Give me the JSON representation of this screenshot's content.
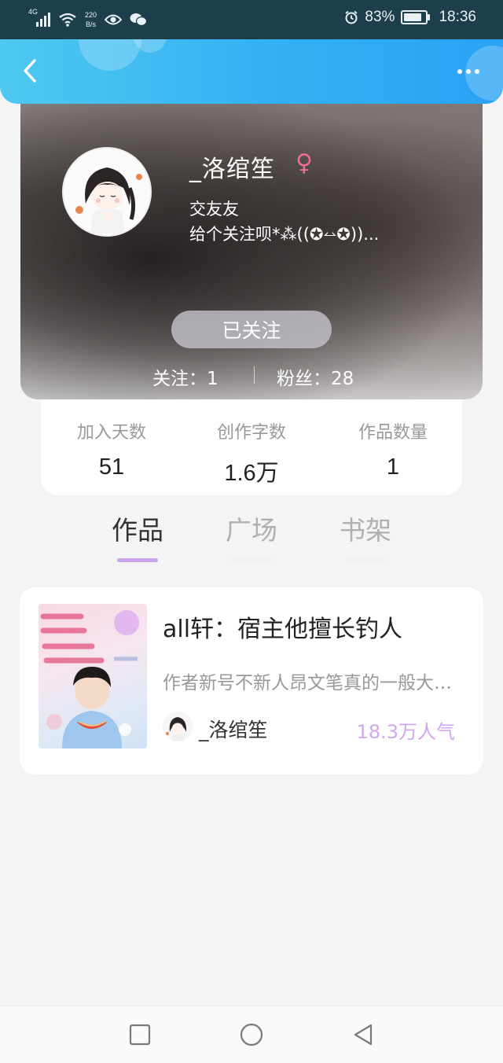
{
  "status_bar": {
    "network": "4G",
    "speed_value": "220",
    "speed_unit": "B/s",
    "battery_percent": "83%",
    "battery_level": 0.83,
    "time": "18:36"
  },
  "nav": {
    "back_icon": "chevron-left-icon",
    "more_icon": "more-dots-icon"
  },
  "profile": {
    "nickname": "_洛绾笙",
    "gender_symbol": "♀",
    "bio_line1": "交友友",
    "bio_line2": "给个关注呗*⁂((✪⥎✪))...",
    "follow_button": "已关注",
    "following_label": "关注：1",
    "fans_label": "粉丝：28"
  },
  "stats": [
    {
      "label": "加入天数",
      "value": "51"
    },
    {
      "label": "创作字数",
      "value": "1.6万"
    },
    {
      "label": "作品数量",
      "value": "1"
    }
  ],
  "tabs": [
    {
      "label": "作品",
      "active": true
    },
    {
      "label": "广场",
      "active": false
    },
    {
      "label": "书架",
      "active": false
    }
  ],
  "books": [
    {
      "title": "all轩：宿主他擅长钓人",
      "description": "作者新号不新人昂文笔真的一般大家多多包涵",
      "author": "_洛绾笙",
      "popularity": "18.3万人气"
    }
  ],
  "colors": {
    "nav_gradient_start": "#4fc9f0",
    "nav_gradient_end": "#2aa2f5",
    "accent_purple": "#c9a6ee",
    "gender_pink": "#f06b8f",
    "popularity_color": "#d1a9ea"
  }
}
